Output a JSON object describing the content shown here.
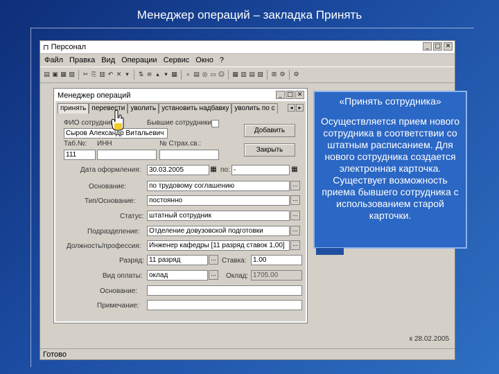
{
  "slide": {
    "title": "Менеджер операций – закладка Принять"
  },
  "colors": {
    "slide_bg": "#1c4da3",
    "callout_bg": "#2b67c4",
    "window_bg": "#d4d0c8"
  },
  "app": {
    "title": "Персонал",
    "menu": [
      "Файл",
      "Правка",
      "Вид",
      "Операции",
      "Сервис",
      "Окно",
      "?"
    ],
    "toolbar_icons": [
      "open-icon",
      "save-icon",
      "print-icon",
      "preview-icon",
      "cut-icon",
      "copy-icon",
      "paste-icon",
      "undo-icon",
      "delete-icon",
      "filter-icon",
      "sort-icon",
      "find-icon",
      "table-icon",
      "chart-icon",
      "report-icon",
      "tree-icon",
      "help-icon"
    ],
    "status": "Готово",
    "status_date": "к 28.02.2005"
  },
  "dialog": {
    "title": "Менеджер операций",
    "tabs": [
      "принять",
      "перевести",
      "уволить",
      "установить надбавку",
      "уволить по с"
    ],
    "labels": {
      "fio": "ФИО сотрудника:",
      "former": "Бывшие сотрудники",
      "tab_no": "Таб.№:",
      "inn": "ИНН",
      "pension": "№ Страх.св.:",
      "date": "Дата оформления:",
      "to": "по:",
      "basis": "Основание:",
      "type": "Тип/Основание:",
      "status": "Статус:",
      "dept": "Подразделение:",
      "position": "Должность/профессия:",
      "grade": "Разряд:",
      "rate": "Ставка:",
      "pay": "Вид оплаты:",
      "salary": "Оклад:",
      "reason": "Основание:",
      "note": "Примечание:"
    },
    "values": {
      "fio": "Сыров Александр Витальевич",
      "tab_no": "111",
      "date": "30.03.2005",
      "to": "-",
      "basis": "по трудовому соглашению",
      "type": "постоянно",
      "status": "штатный сотрудник",
      "dept": "Отделение довузовской подготовки",
      "position": "Инженер кафедры [11 разряд ставок 1,00]",
      "grade": "11 разряд",
      "rate": "1.00",
      "pay": "оклад",
      "salary": "1705.00"
    },
    "buttons": {
      "add": "Добавить",
      "close": "Закрыть"
    }
  },
  "callout": {
    "title": "«Принять сотрудника»",
    "body": "Осуществляется прием нового сотрудника в соответствии со штатным расписанием. Для нового сотрудника создается электронная карточка. Существует возможность приема бывшего сотрудника с использованием старой карточки."
  }
}
